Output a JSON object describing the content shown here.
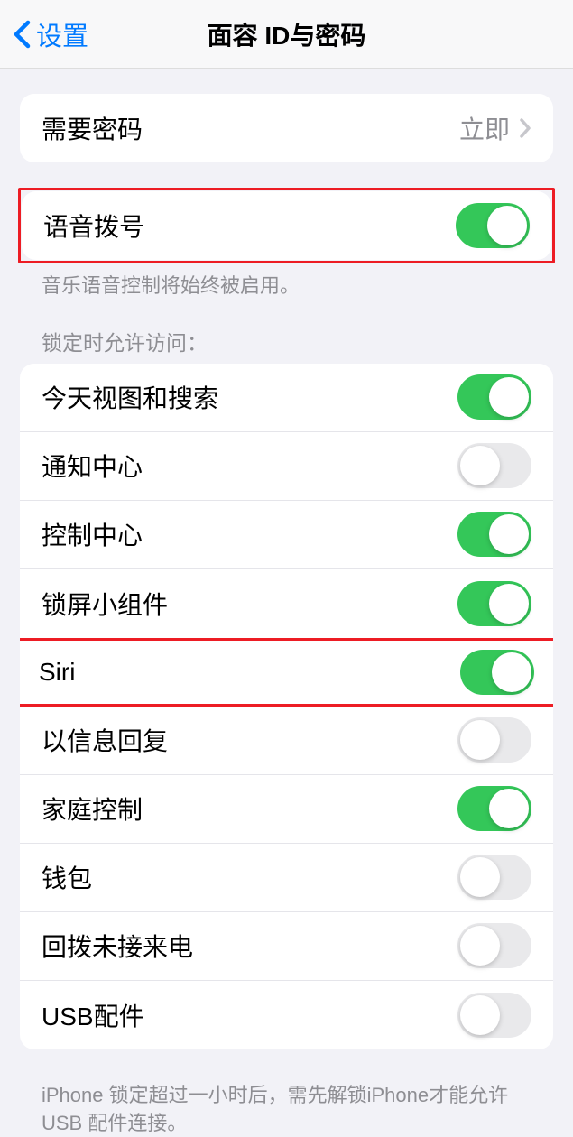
{
  "nav": {
    "back_label": "设置",
    "title": "面容 ID与密码"
  },
  "group1": {
    "require_passcode_label": "需要密码",
    "require_passcode_value": "立即"
  },
  "group2": {
    "voice_dial_label": "语音拨号",
    "voice_dial_on": true,
    "footer": "音乐语音控制将始终被启用。"
  },
  "group3": {
    "header": "锁定时允许访问：",
    "items": {
      "today_view": {
        "label": "今天视图和搜索",
        "on": true
      },
      "notification_center": {
        "label": "通知中心",
        "on": false
      },
      "control_center": {
        "label": "控制中心",
        "on": true
      },
      "lock_widgets": {
        "label": "锁屏小组件",
        "on": true
      },
      "siri": {
        "label": "Siri",
        "on": true
      },
      "reply_with_message": {
        "label": "以信息回复",
        "on": false
      },
      "home_control": {
        "label": "家庭控制",
        "on": true
      },
      "wallet": {
        "label": "钱包",
        "on": false
      },
      "return_missed": {
        "label": "回拨未接来电",
        "on": false
      },
      "usb_accessories": {
        "label": "USB配件",
        "on": false
      }
    },
    "footer": "iPhone 锁定超过一小时后，需先解锁iPhone才能允许 USB 配件连接。"
  }
}
